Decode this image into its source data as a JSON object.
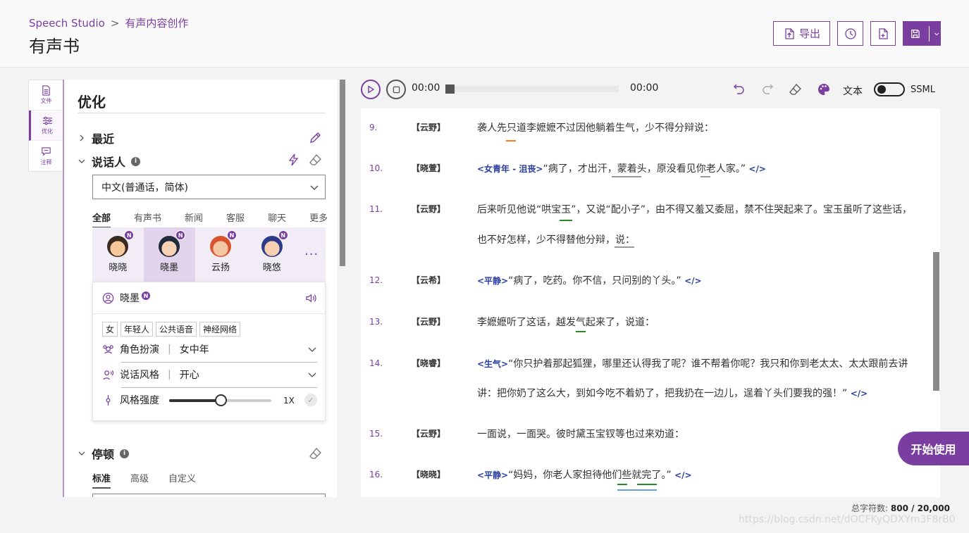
{
  "breadcrumb": {
    "root": "Speech Studio",
    "sep": ">",
    "current": "有声内容创作"
  },
  "page_title": "有声书",
  "header_buttons": {
    "export": "导出"
  },
  "rail": [
    {
      "label": "文件",
      "icon": "document-icon"
    },
    {
      "label": "优化",
      "icon": "sliders-icon"
    },
    {
      "label": "注释",
      "icon": "comment-icon"
    }
  ],
  "panel": {
    "title": "优化",
    "recent": "最近",
    "speaker": "说话人",
    "language": "中文(普通话，简体)",
    "voice_tabs": [
      "全部",
      "有声书",
      "新闻",
      "客服",
      "聊天",
      "更多"
    ],
    "voices": [
      {
        "name": "晓晓",
        "badge": "N"
      },
      {
        "name": "晓墨",
        "badge": "N"
      },
      {
        "name": "云扬",
        "badge": "N"
      },
      {
        "name": "晓悠",
        "badge": "N"
      }
    ],
    "more": "···",
    "selected_voice": {
      "name": "晓墨",
      "badge": "N",
      "tags": [
        "女",
        "年轻人",
        "公共语音",
        "神经网络"
      ],
      "role_label": "角色扮演",
      "role_value": "女中年",
      "style_label": "说话风格",
      "style_value": "开心",
      "intensity_label": "风格强度",
      "intensity_value": "1X",
      "intensity_fraction": 0.5
    },
    "pause": "停顿",
    "pause_tabs": [
      "标准",
      "高级",
      "自定义"
    ]
  },
  "player": {
    "current": "00:00",
    "total": "00:00",
    "progress": 0,
    "text_label": "文本",
    "ssml_label": "SSML"
  },
  "lines": [
    {
      "num": "9.",
      "speaker": "【云野】",
      "style": "",
      "text": "袭人先只道李嬷嬷不过因他躺着生气，少不得分辩说：",
      "text2": "",
      "code": ""
    },
    {
      "num": "10.",
      "speaker": "【晓萱】",
      "style": "<女青年 - 沮丧>",
      "text": "“病了，才出汗，蒙着头，原没看见你老人家。”",
      "text2": "",
      "code": "</>"
    },
    {
      "num": "11.",
      "speaker": "【云野】",
      "style": "",
      "text": "后来听见他说“哄宝玉”，又说“配小子”，由不得又羞又委屈，禁不住哭起来了。宝玉虽听了这些话，",
      "text2": "也不好怎样，少不得替他分辩，说：",
      "code": ""
    },
    {
      "num": "12.",
      "speaker": "【云希】",
      "style": "<平静>",
      "text": "“病了，吃药。你不信，只问别的丫头。”",
      "text2": "",
      "code": "</>"
    },
    {
      "num": "13.",
      "speaker": "【云野】",
      "style": "",
      "text": "李嬷嬷听了这话，越发气起来了，说道：",
      "text2": "",
      "code": ""
    },
    {
      "num": "14.",
      "speaker": "【晓睿】",
      "style": "<生气>",
      "text": "“你只护着那起狐狸，哪里还认得我了呢？谁不帮着你呢？我只和你到老太太、太太跟前去讲",
      "text2": "讲：把你奶了这么大，到如今吃不着奶了，把我扔在一边儿，逞着丫头们要我的强！”",
      "code": "</>"
    },
    {
      "num": "15.",
      "speaker": "【云野】",
      "style": "",
      "text": "一面说，一面哭。彼时黛玉宝钗等也过来劝道：",
      "text2": "",
      "code": ""
    },
    {
      "num": "16.",
      "speaker": "【晓晓】",
      "style": "<平静>",
      "text": "“妈妈，你老人家担待他们些就完了。”",
      "text2": "",
      "code": "</>"
    }
  ],
  "footer": {
    "label": "总字符数:",
    "value": "800 / 20,000"
  },
  "cta": "开始使用",
  "watermark": "https://blog.csdn.net/dOCFKyQDXYm3F8rB0",
  "colors": {
    "accent": "#7a3ea0",
    "style_tag": "#2a3ea0"
  }
}
